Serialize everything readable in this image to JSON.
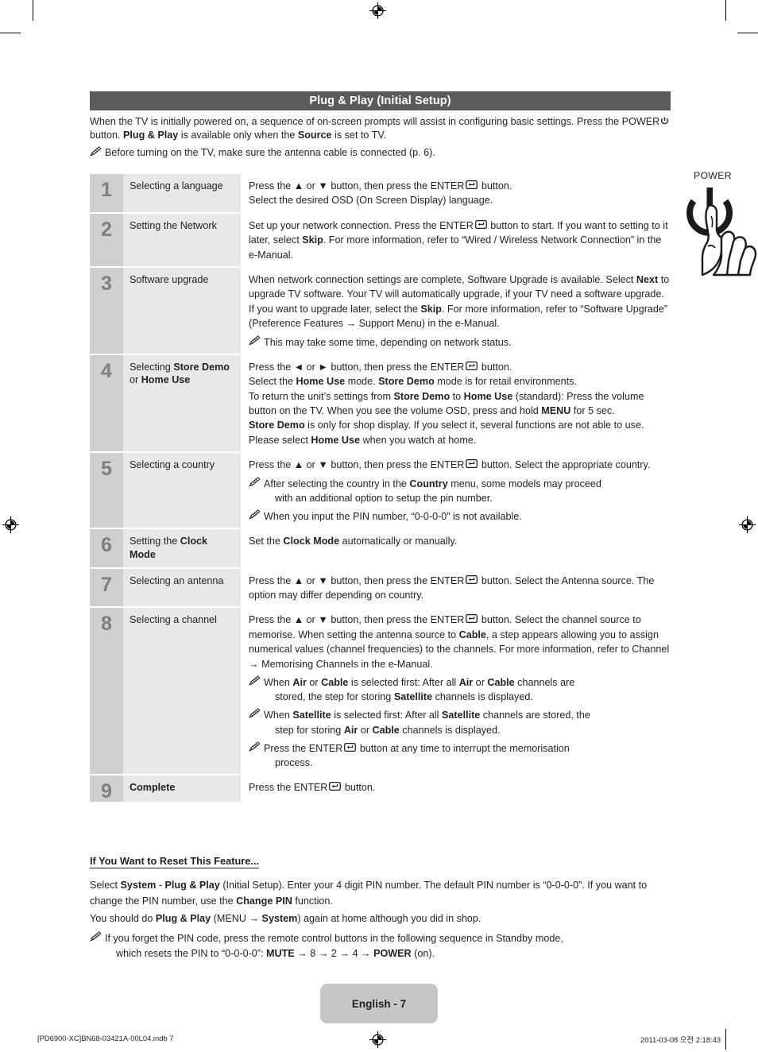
{
  "section": {
    "title": "Plug & Play (Initial Setup)",
    "bar_color": "#5c5a5b"
  },
  "intro": {
    "line1_a": "When the TV is initially powered on, a sequence of on-screen prompts will assist in configuring basic settings. Press the ",
    "line1_power": "POWER",
    "line1_b": " button. ",
    "line1_pp": "Plug & Play",
    "line1_c": " is available only when the ",
    "line1_source": "Source",
    "line1_d": " is set to TV.",
    "note": "Before turning on the TV, make sure the antenna cable is connected (p. 6)."
  },
  "illustration": {
    "label": "POWER",
    "icon": "power-button-press-icon"
  },
  "table": {
    "rows": [
      {
        "num": "1",
        "label_plain": "Selecting a language",
        "desc_l1_a": "Press the ▲ or ▼ button, then press the ENTER",
        "desc_l1_b": " button.",
        "desc_l2": "Select the desired OSD (On Screen Display) language."
      },
      {
        "num": "2",
        "label_plain": "Setting the Network",
        "desc_a": "Set up your network connection. Press the ENTER",
        "desc_b": " button to start. If you want to setting to it later, select ",
        "desc_skip": "Skip",
        "desc_c": ". For more information, refer to “Wired / Wireless Network Connection” in the e-Manual."
      },
      {
        "num": "3",
        "label_plain": "Software upgrade",
        "desc_a": "When network connection settings are complete, Software Upgrade is available. Select ",
        "desc_next": "Next",
        "desc_b": " to upgrade TV software. Your TV will automatically upgrade, if your TV need a software upgrade. If you want to upgrade later, select the ",
        "desc_skip": "Skip",
        "desc_c": ". For more information, refer to “Software Upgrade” (Preference Features → Support Menu) in the e-Manual.",
        "note1": "This may take some time, depending on network status."
      },
      {
        "num": "4",
        "label_a": "Selecting ",
        "label_store": "Store Demo",
        "label_b": " or ",
        "label_home": "Home Use",
        "p1_a": "Press the ◄ or ► button, then press the ENTER",
        "p1_b": " button.",
        "p2_a": "Select the ",
        "p2_home": "Home Use",
        "p2_b": " mode. ",
        "p2_store": "Store Demo",
        "p2_c": " mode is for retail environments.",
        "p3_a": "To return the unit’s settings from ",
        "p3_store": "Store Demo",
        "p3_b": " to ",
        "p3_home": "Home Use",
        "p3_c": " (standard): Press the volume button on the TV. When you see the volume OSD, press and hold ",
        "p3_menu": "MENU",
        "p3_d": " for 5 sec.",
        "p4_store": "Store Demo",
        "p4_a": " is only for shop display. If you select it, several functions are not able to use. Please select ",
        "p4_home": "Home Use",
        "p4_b": " when you watch at home."
      },
      {
        "num": "5",
        "label_plain": "Selecting a country",
        "desc_a": "Press the ▲ or ▼ button, then press the ENTER",
        "desc_b": " button. Select the appropriate country.",
        "note1_a": "After selecting the country in the ",
        "note1_country": "Country",
        "note1_b": " menu, some models may proceed",
        "note1_cont": "with an additional option to setup the pin number.",
        "note2": "When you input the PIN number, “0-0-0-0” is not available."
      },
      {
        "num": "6",
        "label_a": "Setting the ",
        "label_clock": "Clock Mode",
        "desc_a": "Set the ",
        "desc_clock": "Clock Mode",
        "desc_b": " automatically or manually."
      },
      {
        "num": "7",
        "label_plain": "Selecting an antenna",
        "desc_a": "Press the ▲ or ▼ button, then press the ENTER",
        "desc_b": " button. Select the Antenna source. The option may differ depending on country."
      },
      {
        "num": "8",
        "label_plain": "Selecting a channel",
        "desc_a": "Press the ▲ or ▼ button, then press the ENTER",
        "desc_b": " button. Select the channel source to memorise. When setting the antenna source to ",
        "desc_cable": "Cable",
        "desc_c": ", a step appears allowing you to assign numerical values (channel frequencies) to the channels. For more information, refer to Channel → Memorising Channels in the e-Manual.",
        "note1_a": "When ",
        "note1_air": "Air",
        "note1_b": " or ",
        "note1_cable": "Cable",
        "note1_c": " is selected first: After all ",
        "note1_air2": "Air",
        "note1_d": " or ",
        "note1_cable2": "Cable",
        "note1_e": " channels are",
        "note1_cont_a": "stored, the step for storing ",
        "note1_cont_sat": "Satellite",
        "note1_cont_b": " channels is displayed.",
        "note2_a": "When ",
        "note2_sat": "Satellite",
        "note2_b": " is selected first: After all ",
        "note2_sat2": "Satellite",
        "note2_c": " channels are stored, the",
        "note2_cont_a": "step for storing ",
        "note2_cont_air": "Air",
        "note2_cont_b": " or ",
        "note2_cont_cable": "Cable",
        "note2_cont_c": " channels is displayed.",
        "note3_a": "Press the ENTER",
        "note3_b": " button at any time to interrupt the memorisation",
        "note3_cont": "process."
      },
      {
        "num": "9",
        "label_bold": "Complete",
        "desc_a": "Press the ENTER",
        "desc_b": " button."
      }
    ]
  },
  "reset": {
    "heading": "If You Want to Reset This Feature...",
    "p1_a": "Select ",
    "p1_system": "System",
    "p1_b": " - ",
    "p1_pp": "Plug & Play",
    "p1_c": " (Initial Setup). Enter your 4 digit PIN number. The default PIN number is “0-0-0-0”. If you want to change the PIN number, use the ",
    "p1_changepin": "Change PIN",
    "p1_d": " function.",
    "p2_a": "You should do ",
    "p2_pp": "Plug & Play",
    "p2_b": " (MENU → ",
    "p2_system": "System",
    "p2_c": ") again at home although you did in shop.",
    "note_a": "If you forget the PIN code, press the remote control buttons in the following sequence in Standby mode,",
    "note_cont_a": "which resets the PIN to “0-0-0-0”: ",
    "note_mute": "MUTE",
    "note_cont_b": " → 8 → 2 → 4 → ",
    "note_power": "POWER",
    "note_cont_c": " (on)."
  },
  "page_pill": {
    "label": "English - 7"
  },
  "print_footer": {
    "left": "[PD6900-XC]BN68-03421A-00L04.indb   7",
    "right": "2011-03-08   오전 2:18:43"
  }
}
